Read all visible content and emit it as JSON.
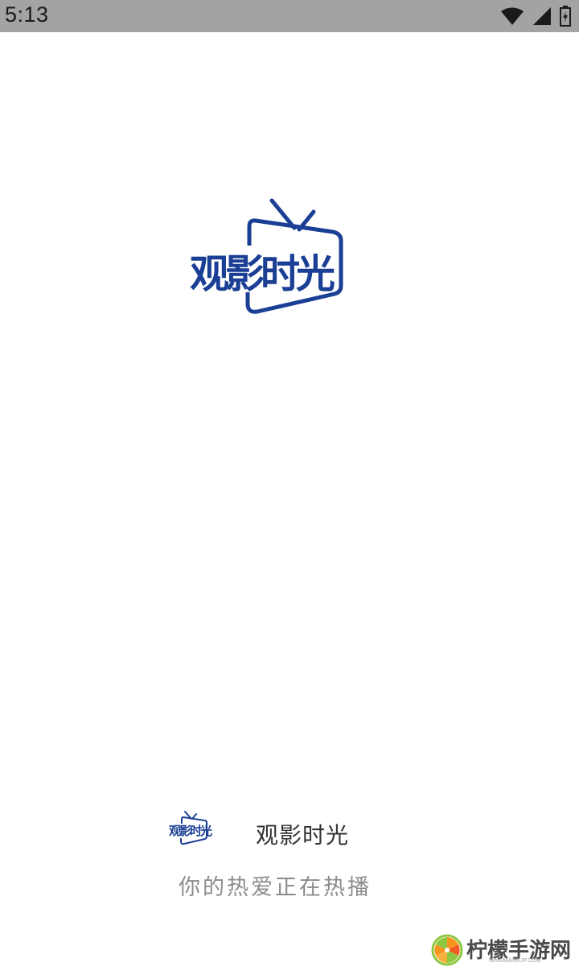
{
  "status_bar": {
    "time": "5:13",
    "icons": [
      "wifi-icon",
      "signal-icon",
      "battery-icon"
    ]
  },
  "splash": {
    "logo_text": "观影时光",
    "logo_color": "#1b3f95"
  },
  "footer": {
    "app_name": "观影时光",
    "slogan": "你的热爱正在热播"
  },
  "watermark": {
    "title": "柠檬手游网",
    "subtitle": "NINGMAKEUP.COM"
  }
}
